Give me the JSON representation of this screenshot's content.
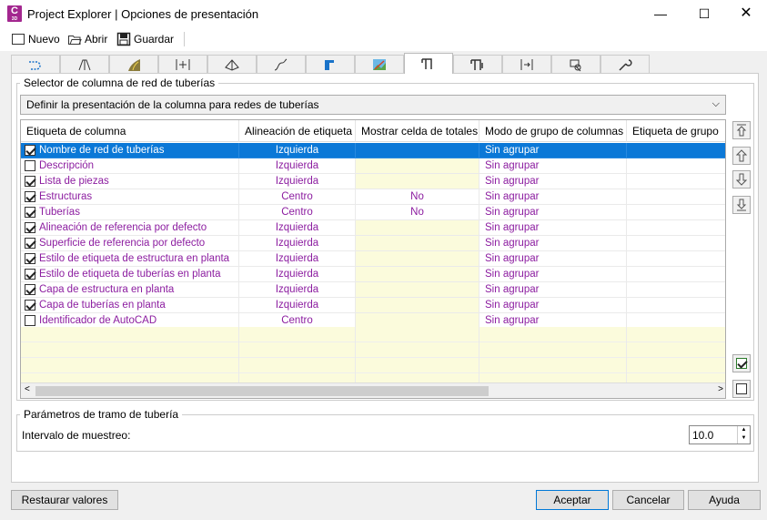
{
  "window": {
    "title": "Project Explorer | Opciones de presentación",
    "app_icon_letter": "C",
    "app_icon_sub": "3D"
  },
  "toolbar": {
    "new_label": "Nuevo",
    "open_label": "Abrir",
    "save_label": "Guardar"
  },
  "tabs": [
    "alignment-tab",
    "profile-tab",
    "corridor-tab",
    "sample-lines-tab",
    "surface-tab",
    "feature-line-tab",
    "parcel-tab",
    "map-tab",
    "pipe-network-tab",
    "pressure-network-tab",
    "section-view-tab",
    "view-tab",
    "settings-tab"
  ],
  "group1": {
    "legend": "Selector de columna de red de tuberías",
    "select_value": "Definir la presentación de la columna para redes de tuberías",
    "columns": [
      "Etiqueta de columna",
      "Alineación de etiqueta",
      "Mostrar celda de totales",
      "Modo de grupo de columnas",
      "Etiqueta de grupo"
    ],
    "rows": [
      {
        "checked": true,
        "label": "Nombre de red de tuberías",
        "align": "Izquierda",
        "totals": "",
        "group": "Sin agrupar",
        "selected": true
      },
      {
        "checked": false,
        "label": "Descripción",
        "align": "Izquierda",
        "totals": "",
        "group": "Sin agrupar"
      },
      {
        "checked": true,
        "label": "Lista de piezas",
        "align": "Izquierda",
        "totals": "",
        "group": "Sin agrupar"
      },
      {
        "checked": true,
        "label": "Estructuras",
        "align": "Centro",
        "totals": "No",
        "group": "Sin agrupar"
      },
      {
        "checked": true,
        "label": "Tuberías",
        "align": "Centro",
        "totals": "No",
        "group": "Sin agrupar"
      },
      {
        "checked": true,
        "label": "Alineación de referencia por defecto",
        "align": "Izquierda",
        "totals": "",
        "group": "Sin agrupar"
      },
      {
        "checked": true,
        "label": "Superficie de referencia por defecto",
        "align": "Izquierda",
        "totals": "",
        "group": "Sin agrupar"
      },
      {
        "checked": true,
        "label": "Estilo de etiqueta de estructura en planta",
        "align": "Izquierda",
        "totals": "",
        "group": "Sin agrupar"
      },
      {
        "checked": true,
        "label": "Estilo de etiqueta de tuberías en planta",
        "align": "Izquierda",
        "totals": "",
        "group": "Sin agrupar"
      },
      {
        "checked": true,
        "label": "Capa de estructura en planta",
        "align": "Izquierda",
        "totals": "",
        "group": "Sin agrupar"
      },
      {
        "checked": true,
        "label": "Capa de tuberías en planta",
        "align": "Izquierda",
        "totals": "",
        "group": "Sin agrupar"
      },
      {
        "checked": false,
        "label": "Identificador de AutoCAD",
        "align": "Centro",
        "totals": "",
        "group": "Sin agrupar"
      }
    ]
  },
  "group2": {
    "legend": "Parámetros de tramo de tubería",
    "interval_label": "Intervalo de muestreo:",
    "interval_value": "10.0"
  },
  "buttons": {
    "restore": "Restaurar valores",
    "accept": "Aceptar",
    "cancel": "Cancelar",
    "help": "Ayuda"
  },
  "colors": {
    "accent": "#0b78d7",
    "value_text": "#8c1da0",
    "yellow_cell": "#fbfbdc"
  }
}
